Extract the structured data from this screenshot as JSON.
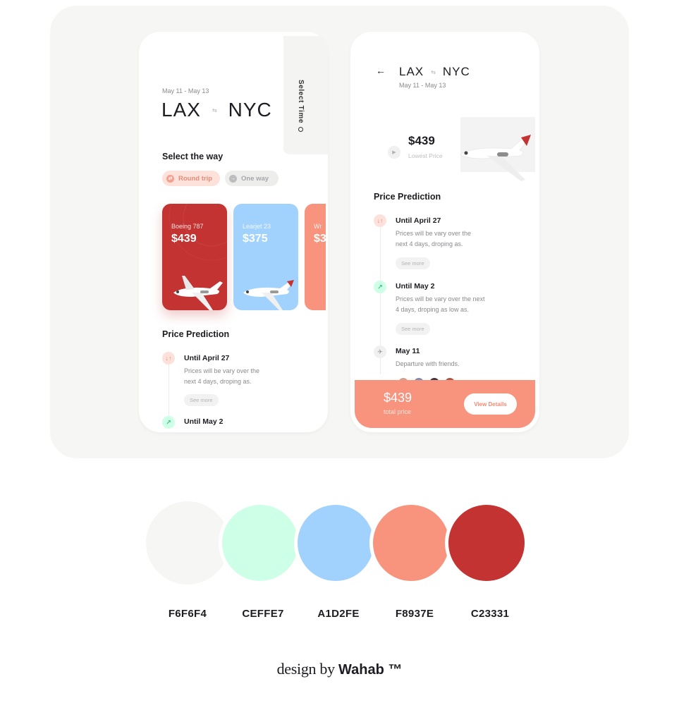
{
  "left_phone": {
    "side_tab": "Select Time",
    "dates": "May 11 - May 13",
    "from": "LAX",
    "to": "NYC",
    "select_way_title": "Select the way",
    "round_trip": "Round trip",
    "one_way": "One way",
    "cards": [
      {
        "model": "Boeing 787",
        "price": "$439"
      },
      {
        "model": "Learjet 23",
        "price": "$375"
      },
      {
        "model": "Wr",
        "price": "$3"
      }
    ],
    "prediction_title": "Price Prediction",
    "timeline": [
      {
        "title": "Until April 27",
        "desc_line1": "Prices will be vary over the",
        "desc_line2": "next 4 days, droping as.",
        "see_more": "See more"
      },
      {
        "title": "Until May 2"
      }
    ]
  },
  "right_phone": {
    "from": "LAX",
    "to": "NYC",
    "dates": "May 11 - May 13",
    "lowest_price": "$439",
    "lowest_label": "Lowest Price",
    "prediction_title": "Price Prediction",
    "timeline": [
      {
        "title": "Until April 27",
        "desc_line1": "Prices will be vary over the",
        "desc_line2": "next 4 days, droping as.",
        "see_more": "See more"
      },
      {
        "title": "Until May 2",
        "desc_line1": "Prices will be vary over the next",
        "desc_line2": "4 days, droping as low as.",
        "see_more": "See more"
      },
      {
        "title": "May 11",
        "desc_line1": "Departure with friends."
      }
    ],
    "total_price": "$439",
    "total_label": "total price",
    "view_details": "View Details"
  },
  "palette": [
    {
      "hex": "F6F6F4",
      "color": "#f6f6f4"
    },
    {
      "hex": "CEFFE7",
      "color": "#ceffe7"
    },
    {
      "hex": "A1D2FE",
      "color": "#a1d2fe"
    },
    {
      "hex": "F8937E",
      "color": "#f8937e"
    },
    {
      "hex": "C23331",
      "color": "#c23331"
    }
  ],
  "credit": {
    "prefix": "design by ",
    "name": "Wahab ™"
  }
}
